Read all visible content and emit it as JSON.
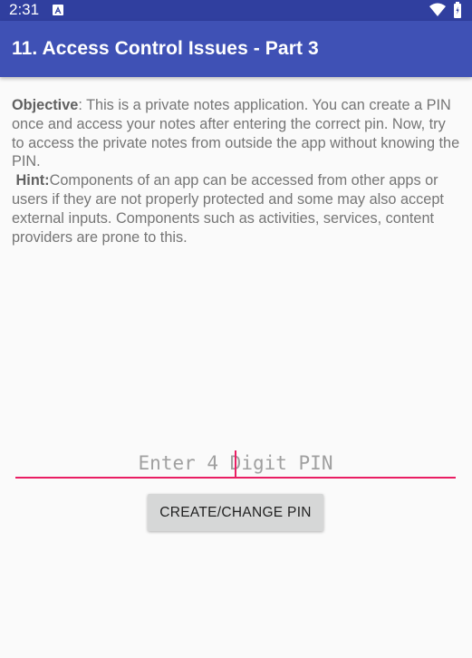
{
  "status_bar": {
    "time": "2:31",
    "icons": [
      "app-notification-icon",
      "wifi-icon",
      "battery-icon"
    ]
  },
  "app_bar": {
    "title": "11. Access Control Issues - Part 3",
    "color": "#3f51b5"
  },
  "content": {
    "objective_label": "Objective",
    "objective_text": ": This is a private notes application. You can create a PIN once and access your notes after entering the correct pin. Now, try to access the private notes from outside the app without knowing the PIN.",
    "hint_label": "Hint:",
    "hint_text": "Components of an app can be accessed from other apps or users if they are not properly protected and some may also accept external inputs. Components such as activities, services, content providers are prone to this."
  },
  "pin_form": {
    "placeholder": "Enter 4 Digit PIN",
    "value": "",
    "button_label": "CREATE/CHANGE PIN",
    "accent_color": "#e91e63"
  }
}
